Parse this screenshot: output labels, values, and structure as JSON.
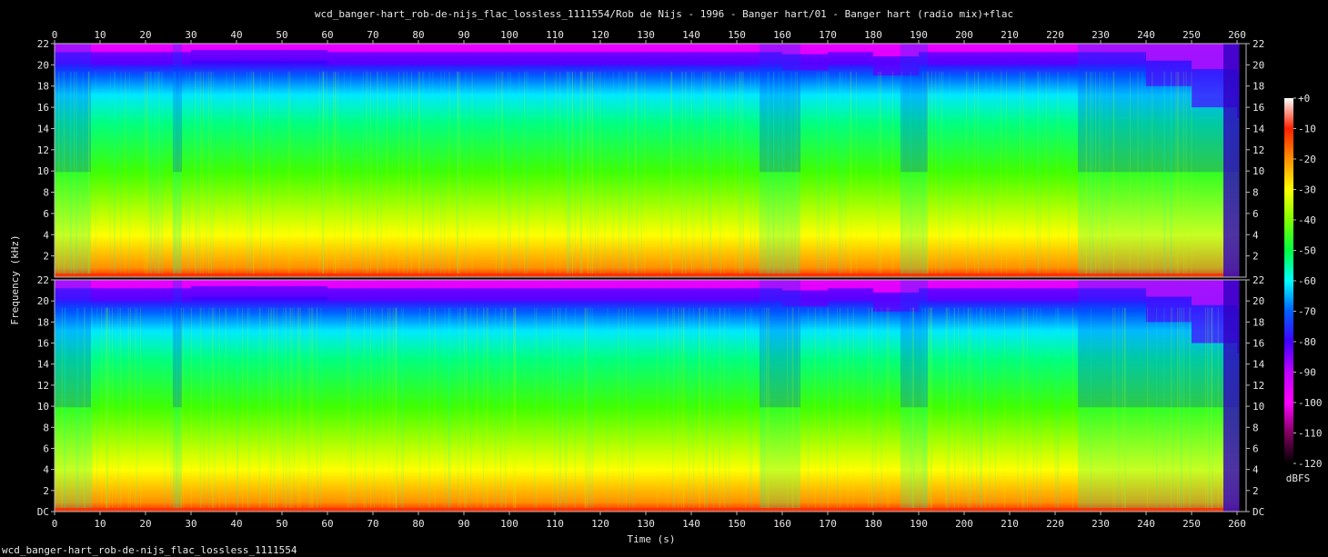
{
  "chart_data": {
    "type": "heatmap",
    "title": "wcd_banger-hart_rob-de-nijs_flac_lossless_1111554/Rob de Nijs - 1996 - Banger hart/01 - Banger hart (radio mix)+flac",
    "footer": "wcd_banger-hart_rob-de-nijs_flac_lossless_1111554",
    "xlabel": "Time (s)",
    "ylabel": "Frequency (kHz)",
    "xlim": [
      0,
      262
    ],
    "ylim": [
      0,
      22
    ],
    "x_ticks": [
      "0",
      "10",
      "20",
      "30",
      "40",
      "50",
      "60",
      "70",
      "80",
      "90",
      "100",
      "110",
      "120",
      "130",
      "140",
      "150",
      "160",
      "170",
      "180",
      "190",
      "200",
      "210",
      "220",
      "230",
      "240",
      "250",
      "260"
    ],
    "y_ticks_top": [
      "2",
      "4",
      "6",
      "8",
      "10",
      "12",
      "14",
      "16",
      "18",
      "20",
      "22"
    ],
    "y_ticks_bottom": [
      "DC",
      "2",
      "4",
      "6",
      "8",
      "10",
      "12",
      "14",
      "16",
      "18",
      "20",
      "22"
    ],
    "colorbar": {
      "label": "dBFS",
      "range": [
        -120,
        0
      ],
      "ticks": [
        "+0",
        "-10",
        "-20",
        "-30",
        "-40",
        "-50",
        "-60",
        "-70",
        "-80",
        "-90",
        "-100",
        "-110",
        "-120"
      ],
      "colors": [
        "#ffffff",
        "#ff2000",
        "#ff9000",
        "#ffff00",
        "#80ff00",
        "#00ff40",
        "#00ffff",
        "#0060ff",
        "#4000ff",
        "#c000ff",
        "#ff00ff",
        "#800060",
        "#000000"
      ]
    },
    "series": [
      {
        "name": "",
        "cutoff_khz": [
          20,
          20,
          20,
          20.5,
          20.5,
          20.5,
          20,
          20,
          20,
          20,
          20,
          20,
          20,
          20,
          20,
          20,
          19.5,
          20,
          19,
          20,
          20,
          20,
          20,
          20,
          18,
          16,
          15
        ],
        "quiet_regions_s": [
          [
            0,
            8
          ],
          [
            26,
            28
          ],
          [
            155,
            164
          ],
          [
            186,
            192
          ],
          [
            225,
            240
          ],
          [
            240,
            262
          ]
        ]
      },
      {
        "name": "",
        "cutoff_khz": [
          20,
          20,
          20,
          20.5,
          20.5,
          20.5,
          20,
          20,
          20,
          20,
          20,
          20,
          20,
          20,
          20,
          20,
          19.5,
          20,
          19,
          20,
          20,
          20,
          20,
          20,
          18,
          16,
          15
        ],
        "quiet_regions_s": [
          [
            0,
            8
          ],
          [
            26,
            28
          ],
          [
            155,
            164
          ],
          [
            186,
            192
          ],
          [
            225,
            240
          ],
          [
            240,
            262
          ]
        ]
      }
    ]
  }
}
